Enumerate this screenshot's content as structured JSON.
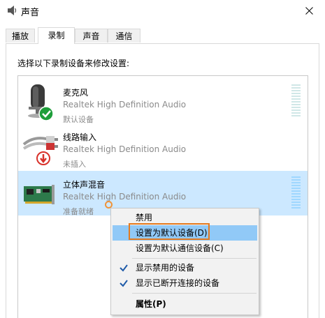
{
  "window": {
    "title": "声音",
    "close_icon": "close-icon"
  },
  "tabs": [
    {
      "label": "播放"
    },
    {
      "label": "录制"
    },
    {
      "label": "声音"
    },
    {
      "label": "通信"
    }
  ],
  "instruction": "选择以下录制设备来修改设置:",
  "devices": [
    {
      "name": "麦克风",
      "driver": "Realtek High Definition Audio",
      "status": "默认设备",
      "icon": "microphone-icon",
      "badge": "default-check-badge-icon"
    },
    {
      "name": "线路输入",
      "driver": "Realtek High Definition Audio",
      "status": "未插入",
      "icon": "line-in-cable-icon",
      "badge": "unplugged-arrow-badge-icon"
    },
    {
      "name": "立体声混音",
      "driver": "Realtek High Definition Audio",
      "status": "准备就绪",
      "icon": "sound-card-icon",
      "selected": true
    }
  ],
  "context_menu": {
    "items": [
      {
        "label": "禁用"
      },
      {
        "label": "设置为默认设备(D)",
        "highlighted": true
      },
      {
        "label": "设置为默认通信设备(C)"
      },
      {
        "label": "显示禁用的设备",
        "checked": true
      },
      {
        "label": "显示已断开连接的设备",
        "checked": true
      },
      {
        "label": "属性(P)",
        "bold": true
      }
    ]
  },
  "colors": {
    "selection": "#cce8ff",
    "menu_hover": "#91c9f7",
    "annotation": "#e47a1e",
    "default_badge": "#1e9e3a",
    "unplugged_badge": "#d8312a"
  }
}
